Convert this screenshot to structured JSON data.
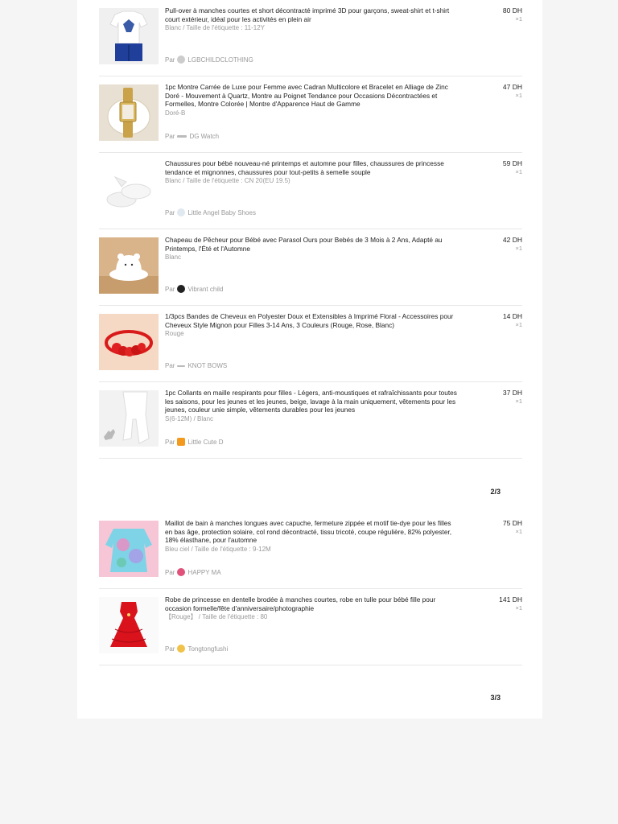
{
  "seller_prefix": "Par",
  "items": [
    {
      "title": "Pull-over à manches courtes et short décontracté imprimé 3D pour garçons, sweat-shirt et t-shirt court extérieur, idéal pour les activités en plein air",
      "variant": "Blanc / Taille de l'étiquette : 11-12Y",
      "seller": "LGBCHILDCLOTHING",
      "price": "80 DH",
      "qty": "×1"
    },
    {
      "title": "1pc Montre Carrée de Luxe pour Femme avec Cadran Multicolore et Bracelet en Alliage de Zinc Doré - Mouvement à Quartz, Montre au Poignet Tendance pour Occasions Décontractées et Formelles, Montre Colorée | Montre d'Apparence Haut de Gamme",
      "variant": "Doré-B",
      "seller": "DG Watch",
      "price": "47 DH",
      "qty": "×1"
    },
    {
      "title": "Chaussures pour bébé nouveau-né printemps et automne pour filles, chaussures de princesse tendance et mignonnes, chaussures pour tout-petits à semelle souple",
      "variant": "Blanc / Taille de l'étiquette : CN 20(EU 19.5)",
      "seller": "Little Angel Baby Shoes",
      "price": "59 DH",
      "qty": "×1"
    },
    {
      "title": "Chapeau de Pêcheur pour Bébé avec Parasol Ours pour Bebés de 3 Mois à 2 Ans, Adapté au Printemps, l'Été et l'Automne",
      "variant": "Blanc",
      "seller": "Vibrant child",
      "price": "42 DH",
      "qty": "×1"
    },
    {
      "title": "1/3pcs Bandes de Cheveux en Polyester Doux et Extensibles à Imprimé Floral - Accessoires pour Cheveux Style Mignon pour Filles 3-14 Ans, 3 Couleurs (Rouge, Rose, Blanc)",
      "variant": "Rouge",
      "seller": "KNOT BOWS",
      "price": "14 DH",
      "qty": "×1"
    },
    {
      "title": "1pc Collants en maille respirants pour filles - Légers, anti-moustiques et rafraîchissants pour toutes les saisons, pour les jeunes et les jeunes, beige, lavage à la main uniquement, vêtements pour les jeunes, couleur unie simple, vêtements durables pour les jeunes",
      "variant": "S(6-12M) / Blanc",
      "seller": "Little Cute D",
      "price": "37 DH",
      "qty": "×1"
    },
    {
      "title": "Maillot de bain à manches longues avec capuche, fermeture zippée et motif tie-dye pour les filles en bas âge, protection solaire, col rond décontracté, tissu tricoté, coupe régulière, 82% polyester, 18% élasthane, pour l'automne",
      "variant": "Bleu ciel / Taille de l'étiquette : 9-12M",
      "seller": "HAPPY MA",
      "price": "75 DH",
      "qty": "×1"
    },
    {
      "title": "Robe de princesse en dentelle brodée à manches courtes, robe en tulle pour bébé fille pour occasion formelle/fête d'anniversaire/photographie",
      "variant": "【Rouge】 / Taille de l'étiquette : 80",
      "seller": "Tongtongfushi",
      "price": "141 DH",
      "qty": "×1"
    }
  ],
  "pagers": [
    "2/3",
    "3/3"
  ],
  "colors": {
    "page_bg": "#f5f5f5",
    "sheet_bg": "#ffffff",
    "muted_text": "#999999",
    "divider": "#e8e8e8"
  }
}
